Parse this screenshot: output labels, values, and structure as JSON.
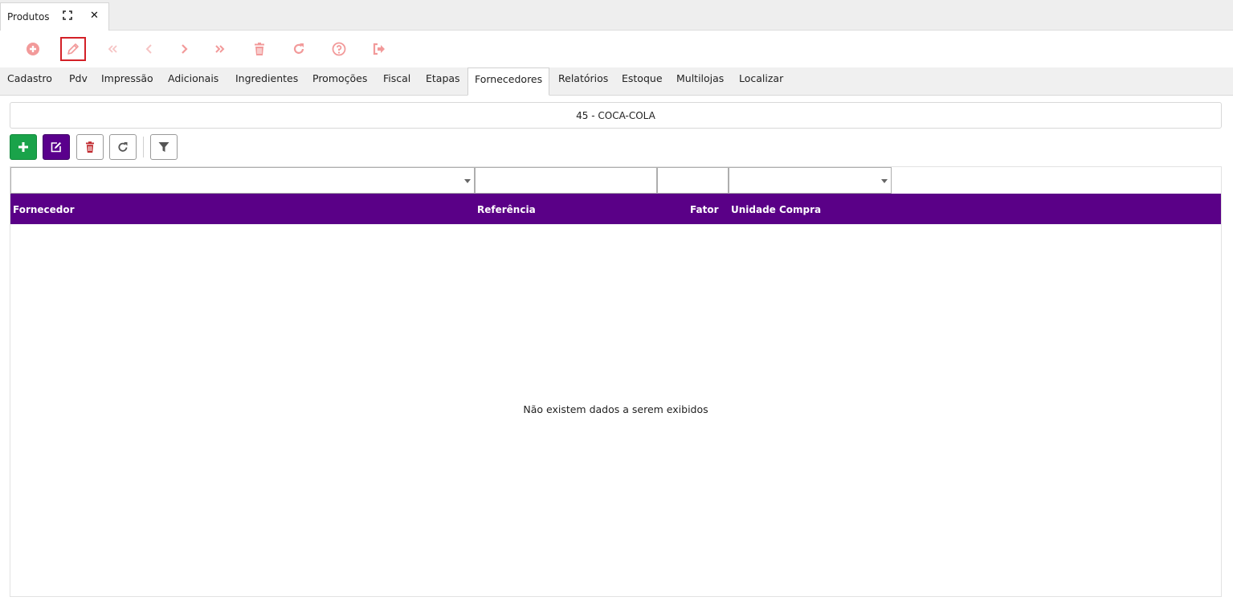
{
  "window_tab": {
    "title": "Produtos",
    "maximize_icon": "maximize-icon",
    "close_icon": "close-icon",
    "close_glyph": "✕"
  },
  "toolbar": {
    "accent_color": "#f29a9a",
    "selected_border_color": "#d32027",
    "buttons": [
      {
        "name": "new-button",
        "icon": "plus-circle-icon"
      },
      {
        "name": "edit-button",
        "icon": "pencil-icon",
        "selected": true
      },
      {
        "name": "first-record-button",
        "icon": "double-chevron-left-icon"
      },
      {
        "name": "previous-record-button",
        "icon": "chevron-left-icon"
      },
      {
        "name": "next-record-button",
        "icon": "chevron-right-icon"
      },
      {
        "name": "last-record-button",
        "icon": "double-chevron-right-icon"
      },
      {
        "name": "delete-button",
        "icon": "trash-icon"
      },
      {
        "name": "refresh-button",
        "icon": "refresh-icon"
      },
      {
        "name": "help-button",
        "icon": "question-circle-icon"
      },
      {
        "name": "exit-button",
        "icon": "sign-out-icon"
      }
    ]
  },
  "section_tabs": [
    {
      "label": "Cadastro"
    },
    {
      "label": "Pdv"
    },
    {
      "label": "Impressão"
    },
    {
      "label": "Adicionais"
    },
    {
      "label": "Ingredientes"
    },
    {
      "label": "Promoções"
    },
    {
      "label": "Fiscal"
    },
    {
      "label": "Etapas"
    },
    {
      "label": "Fornecedores",
      "active": true
    },
    {
      "label": "Relatórios"
    },
    {
      "label": "Estoque"
    },
    {
      "label": "Multilojas"
    },
    {
      "label": "Localizar"
    }
  ],
  "product": {
    "title": "45 - COCA-COLA"
  },
  "actions": {
    "colors": {
      "add": "#1aa34a",
      "edit": "#5a008c",
      "delete_icon": "#c0282d"
    },
    "icons": [
      "plus-icon",
      "edit-icon",
      "trash-icon",
      "refresh-icon",
      "filter-icon"
    ]
  },
  "grid": {
    "header_color": "#5a0087",
    "columns": [
      {
        "label": "Fornecedor"
      },
      {
        "label": "Referência"
      },
      {
        "label": "Fator"
      },
      {
        "label": "Unidade Compra"
      }
    ],
    "rows": [],
    "empty_message": "Não existem dados a serem exibidos"
  }
}
